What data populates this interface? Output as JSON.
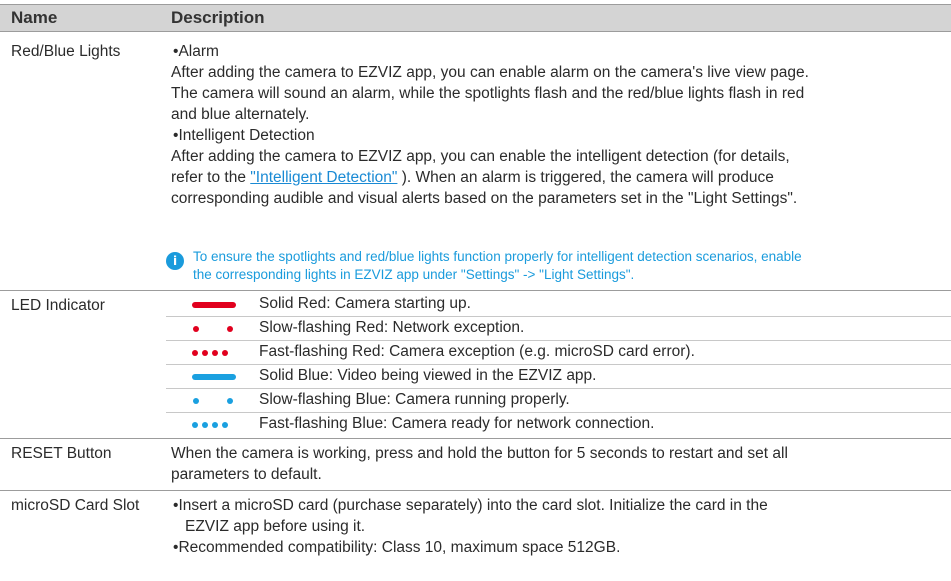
{
  "header": {
    "name": "Name",
    "description": "Description"
  },
  "rows": {
    "lights": {
      "name": "Red/Blue Lights",
      "alarm_title": "Alarm",
      "alarm_desc_1": "After adding the camera to EZVIZ app, you can enable alarm on the camera's live view page.",
      "alarm_desc_2": "The camera will sound an alarm, while the spotlights flash and the red/blue lights flash in red",
      "alarm_desc_3": "and blue alternately.",
      "detect_title": "Intelligent Detection",
      "detect_desc_1": "After adding the camera to EZVIZ app, you can enable the intelligent detection (for details,",
      "detect_desc_2a": "refer to the ",
      "detect_link": "\"Intelligent Detection\"",
      "detect_desc_2b": " ). When an alarm is triggered, the camera will produce",
      "detect_desc_3": "corresponding audible and visual alerts based on the parameters set in the \"Light Settings\".",
      "note_1": "To ensure the spotlights and red/blue lights function properly for intelligent detection scenarios, enable",
      "note_2": "the corresponding lights in EZVIZ app under \"Settings\" -> \"Light Settings\"."
    },
    "led": {
      "name": "LED Indicator",
      "items": [
        {
          "text": "Solid Red: Camera starting up.",
          "color": "#e1001e",
          "pattern": "solid"
        },
        {
          "text": "Slow-flashing Red: Network exception.",
          "color": "#e1001e",
          "pattern": "slow"
        },
        {
          "text": "Fast-flashing Red: Camera exception (e.g. microSD card error).",
          "color": "#e1001e",
          "pattern": "fast"
        },
        {
          "text": "Solid Blue: Video being viewed in the EZVIZ app.",
          "color": "#1aa0e0",
          "pattern": "solid"
        },
        {
          "text": "Slow-flashing Blue: Camera running properly.",
          "color": "#1aa0e0",
          "pattern": "slow"
        },
        {
          "text": "Fast-flashing Blue: Camera ready for network connection.",
          "color": "#1aa0e0",
          "pattern": "fast"
        }
      ]
    },
    "reset": {
      "name": "RESET Button",
      "desc_1": "When the camera is working, press and hold the button for 5 seconds to restart and set all",
      "desc_2": "parameters to default."
    },
    "sd": {
      "name": "microSD Card Slot",
      "b1_1": "Insert a microSD card (purchase separately) into the card slot. Initialize the card in the",
      "b1_2": "EZVIZ app before using it.",
      "b2": "Recommended compatibility: Class 10, maximum space 512GB."
    }
  },
  "bullet_char": "•",
  "info_icon": "info-icon"
}
